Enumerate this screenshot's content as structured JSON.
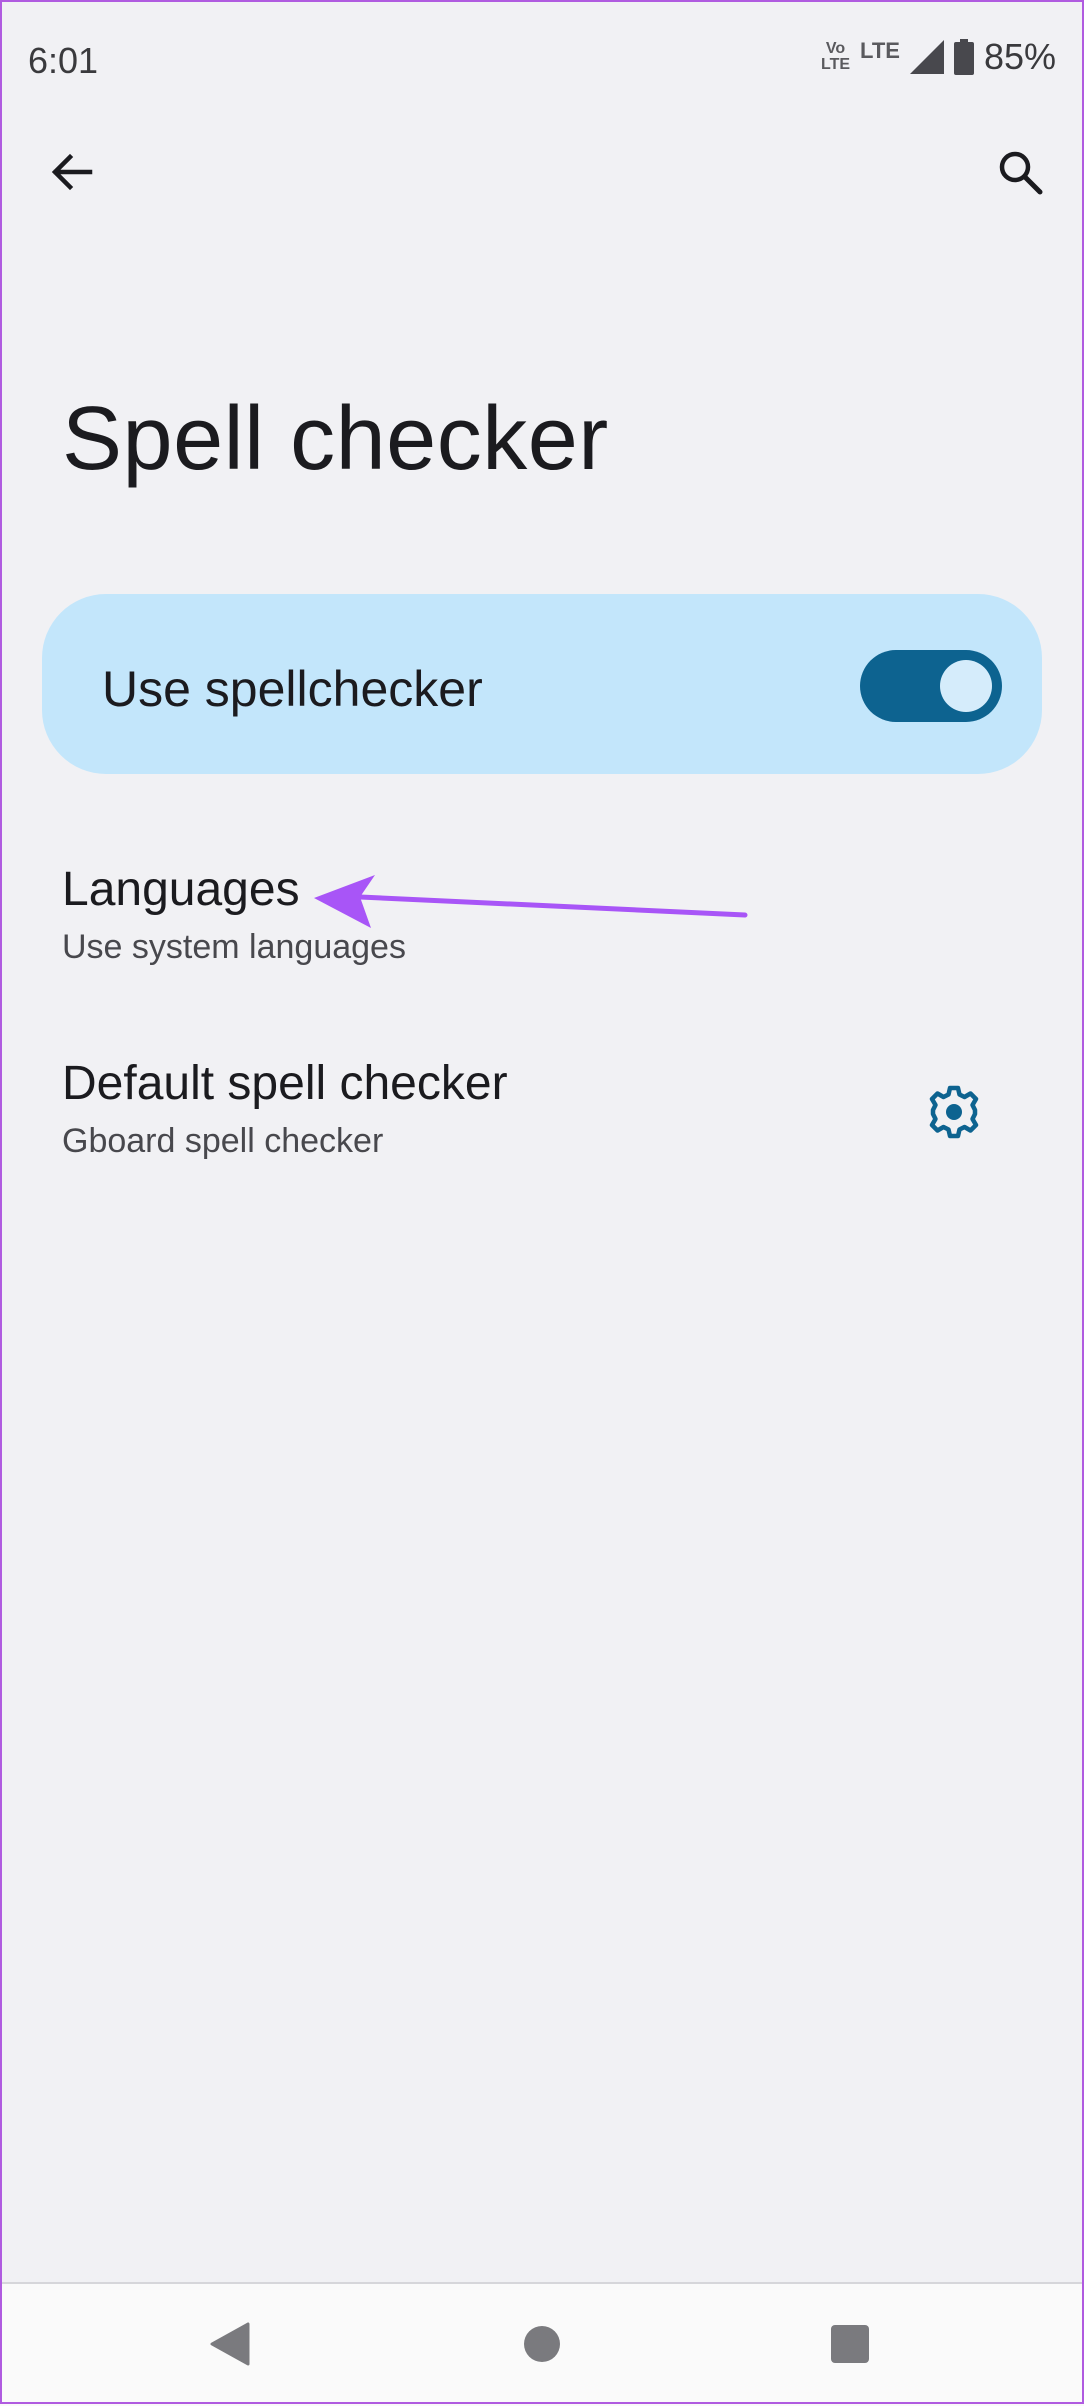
{
  "status_bar": {
    "time": "6:01",
    "volte_top": "Vo",
    "volte_bottom": "LTE",
    "network": "LTE",
    "battery": "85%",
    "icons": [
      "volte-icon",
      "lte-icon",
      "signal-icon",
      "battery-icon"
    ]
  },
  "app_bar": {
    "back_icon": "arrow-left-icon",
    "search_icon": "search-icon"
  },
  "page": {
    "title": "Spell checker"
  },
  "main_switch": {
    "label": "Use spellchecker",
    "checked": true,
    "accent": "#0d6390",
    "card_color": "#c3e6fb"
  },
  "items": [
    {
      "title": "Languages",
      "summary": "Use system languages"
    },
    {
      "title": "Default spell checker",
      "summary": "Gboard spell checker",
      "action_icon": "gear-icon"
    }
  ],
  "annotation": {
    "type": "arrow",
    "color": "#a855f7"
  },
  "nav_bar": {
    "icons": [
      "nav-back-icon",
      "nav-home-icon",
      "nav-recents-icon"
    ]
  }
}
